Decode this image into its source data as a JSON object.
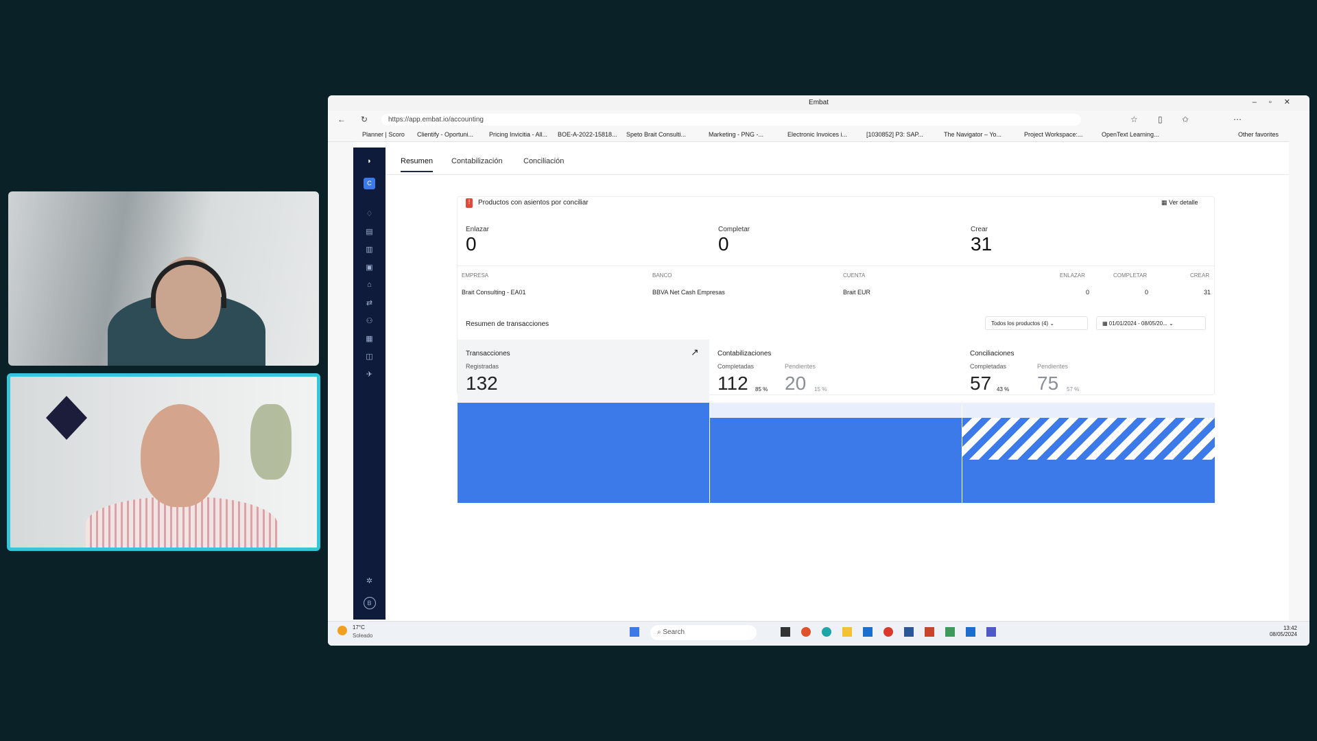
{
  "browser": {
    "window_title": "Embat",
    "url": "https://app.embat.io/accounting"
  },
  "bookmarks": [
    "Planner | Scoro",
    "Clientify - Oportuni...",
    "Pricing Invicitia - All...",
    "BOE-A-2022-15818...",
    "Speto Brait Consulti...",
    "Marketing - PNG -...",
    "Electronic Invoices i...",
    "[1030852] P3: SAP...",
    "The Navigator – Yo...",
    "Project Workspace:...",
    "OpenText Learning..."
  ],
  "other_favorites": "Other favorites",
  "tabs": [
    "Resumen",
    "Contabilización",
    "Conciliación"
  ],
  "alert": {
    "badge": "!",
    "title": "Productos con asientos por conciliar",
    "link": "Ver detalle"
  },
  "kpis": [
    {
      "label": "Enlazar",
      "value": "0"
    },
    {
      "label": "Completar",
      "value": "0"
    },
    {
      "label": "Crear",
      "value": "31"
    }
  ],
  "table": {
    "headers": [
      "EMPRESA",
      "BANCO",
      "CUENTA",
      "ENLAZAR",
      "COMPLETAR",
      "CREAR"
    ],
    "row": [
      "Brait Consulting - EA01",
      "BBVA Net Cash Empresas",
      "Brait EUR",
      "0",
      "0",
      "31"
    ]
  },
  "summary": {
    "title": "Resumen de transacciones",
    "filter": "Todos los productos (4)",
    "date": "01/01/2024 - 08/05/20..."
  },
  "transacciones": {
    "title": "Transacciones",
    "sub": "Registradas",
    "value": "132"
  },
  "contab": {
    "title": "Contabilizaciones",
    "c_label": "Completadas",
    "c_value": "112",
    "c_pct": "85 %",
    "p_label": "Pendientes",
    "p_value": "20",
    "p_pct": "15 %"
  },
  "concil": {
    "title": "Conciliaciones",
    "c_label": "Completadas",
    "c_value": "57",
    "c_pct": "43 %",
    "p_label": "Pendientes",
    "p_value": "75",
    "p_pct": "57 %"
  },
  "weather": {
    "temp": "17°C",
    "desc": "Soleado"
  },
  "search_placeholder": "Search",
  "clock": {
    "time": "13:42",
    "date": "08/05/2024"
  },
  "user_initial": "B",
  "company_initial": "C",
  "colors": {
    "accent": "#3b7ae8",
    "sidebar": "#0f1b3b",
    "video_border": "#35c7d9"
  }
}
